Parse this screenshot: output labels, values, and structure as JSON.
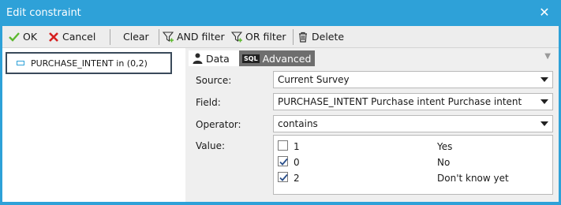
{
  "window": {
    "title": "Edit constraint"
  },
  "toolbar": {
    "ok_label": "OK",
    "cancel_label": "Cancel",
    "clear_label": "Clear",
    "and_filter_label": "AND filter",
    "or_filter_label": "OR filter",
    "delete_label": "Delete"
  },
  "tree": {
    "item_label": "PURCHASE_INTENT in (0,2)"
  },
  "tabs": {
    "data_label": "Data",
    "advanced_label": "Advanced",
    "sql_badge": "SQL"
  },
  "form": {
    "source": {
      "label": "Source:",
      "value": "Current Survey"
    },
    "field": {
      "label": "Field:",
      "value": "PURCHASE_INTENT Purchase intent Purchase intent"
    },
    "operator": {
      "label": "Operator:",
      "value": "contains"
    },
    "value": {
      "label": "Value:"
    }
  },
  "values": [
    {
      "code": "1",
      "label": "Yes",
      "checked": false
    },
    {
      "code": "0",
      "label": "No",
      "checked": true
    },
    {
      "code": "2",
      "label": "Don't know yet",
      "checked": true
    }
  ],
  "colors": {
    "titlebar": "#2ea1d8",
    "ok_icon": "#5cb82e",
    "cancel_icon": "#d62020",
    "tab_advanced": "#6e6e6e"
  }
}
